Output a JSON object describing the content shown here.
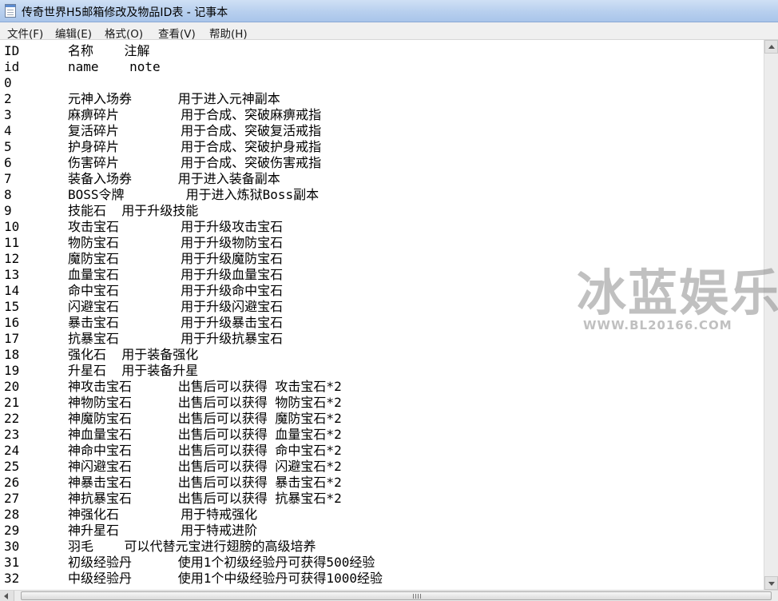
{
  "window": {
    "title": "传奇世界H5邮箱修改及物品ID表 - 记事本"
  },
  "menu": [
    "文件(F)",
    "编辑(E)",
    "格式(O)",
    "查看(V)",
    "帮助(H)"
  ],
  "watermark": {
    "main": "冰蓝娱乐",
    "sub": "WWW.BL20166.COM"
  },
  "lines": [
    {
      "id": "ID",
      "rest": "名称    注解"
    },
    {
      "id": "id",
      "rest": "name    note"
    },
    {
      "id": "0",
      "rest": ""
    },
    {
      "id": "2",
      "rest": "元神入场券      用于进入元神副本"
    },
    {
      "id": "3",
      "rest": "麻痹碎片        用于合成、突破麻痹戒指"
    },
    {
      "id": "4",
      "rest": "复活碎片        用于合成、突破复活戒指"
    },
    {
      "id": "5",
      "rest": "护身碎片        用于合成、突破护身戒指"
    },
    {
      "id": "6",
      "rest": "伤害碎片        用于合成、突破伤害戒指"
    },
    {
      "id": "7",
      "rest": "装备入场券      用于进入装备副本"
    },
    {
      "id": "8",
      "rest": "BOSS令牌        用于进入炼狱Boss副本"
    },
    {
      "id": "9",
      "rest": "技能石  用于升级技能"
    },
    {
      "id": "10",
      "rest": "攻击宝石        用于升级攻击宝石"
    },
    {
      "id": "11",
      "rest": "物防宝石        用于升级物防宝石"
    },
    {
      "id": "12",
      "rest": "魔防宝石        用于升级魔防宝石"
    },
    {
      "id": "13",
      "rest": "血量宝石        用于升级血量宝石"
    },
    {
      "id": "14",
      "rest": "命中宝石        用于升级命中宝石"
    },
    {
      "id": "15",
      "rest": "闪避宝石        用于升级闪避宝石"
    },
    {
      "id": "16",
      "rest": "暴击宝石        用于升级暴击宝石"
    },
    {
      "id": "17",
      "rest": "抗暴宝石        用于升级抗暴宝石"
    },
    {
      "id": "18",
      "rest": "强化石  用于装备强化"
    },
    {
      "id": "19",
      "rest": "升星石  用于装备升星"
    },
    {
      "id": "20",
      "rest": "神攻击宝石      出售后可以获得 攻击宝石*2"
    },
    {
      "id": "21",
      "rest": "神物防宝石      出售后可以获得 物防宝石*2"
    },
    {
      "id": "22",
      "rest": "神魔防宝石      出售后可以获得 魔防宝石*2"
    },
    {
      "id": "23",
      "rest": "神血量宝石      出售后可以获得 血量宝石*2"
    },
    {
      "id": "24",
      "rest": "神命中宝石      出售后可以获得 命中宝石*2"
    },
    {
      "id": "25",
      "rest": "神闪避宝石      出售后可以获得 闪避宝石*2"
    },
    {
      "id": "26",
      "rest": "神暴击宝石      出售后可以获得 暴击宝石*2"
    },
    {
      "id": "27",
      "rest": "神抗暴宝石      出售后可以获得 抗暴宝石*2"
    },
    {
      "id": "28",
      "rest": "神强化石        用于特戒强化"
    },
    {
      "id": "29",
      "rest": "神升星石        用于特戒进阶"
    },
    {
      "id": "30",
      "rest": "羽毛    可以代替元宝进行翅膀的高级培养"
    },
    {
      "id": "31",
      "rest": "初级经验丹      使用1个初级经验丹可获得500经验"
    },
    {
      "id": "32",
      "rest": "中级经验丹      使用1个中级经验丹可获得1000经验"
    }
  ]
}
